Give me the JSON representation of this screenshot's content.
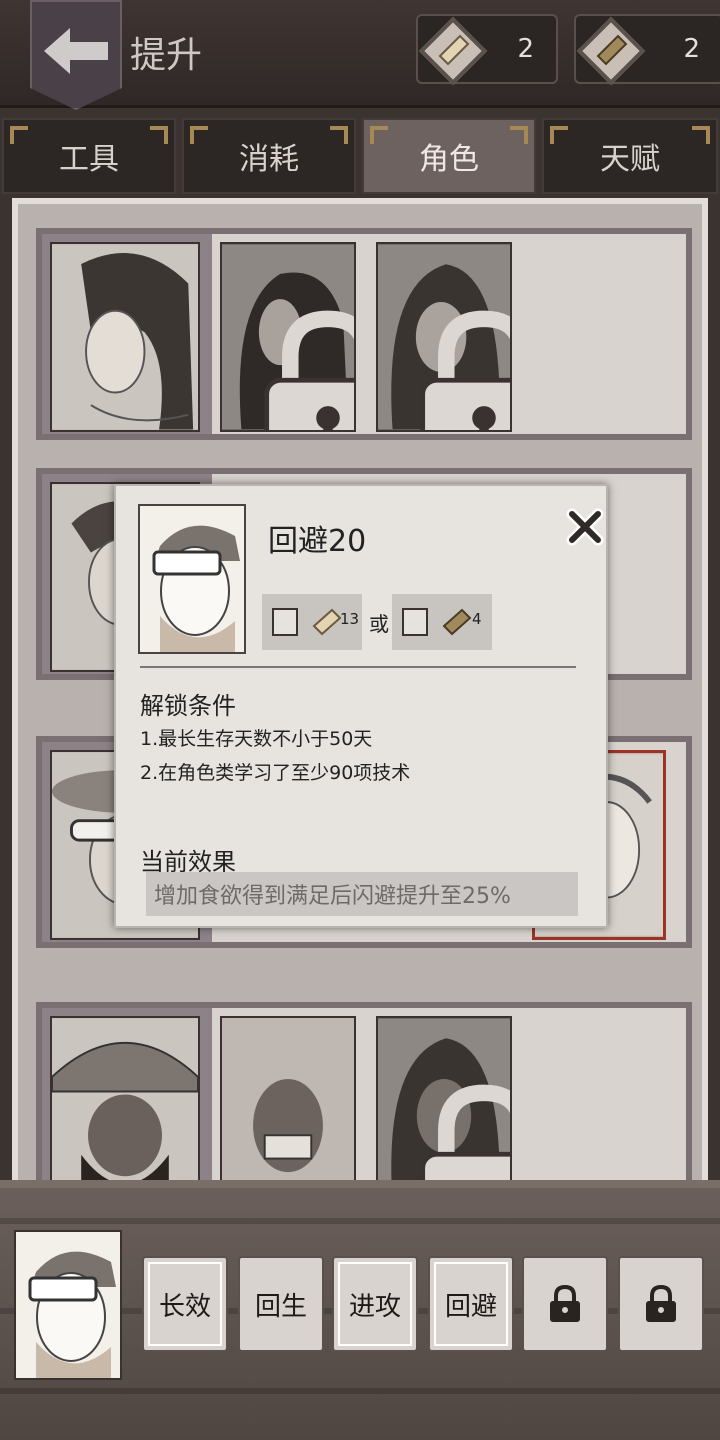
{
  "header": {
    "title": "提升",
    "currency": [
      {
        "icon": "light-scroll-icon",
        "count": "2"
      },
      {
        "icon": "dark-scroll-icon",
        "count": "2"
      }
    ]
  },
  "tabs": [
    {
      "label": "工具"
    },
    {
      "label": "消耗"
    },
    {
      "label": "角色",
      "active": true
    },
    {
      "label": "天赋"
    }
  ],
  "popup": {
    "title": "回避20",
    "cost_a": "13",
    "or_label": "或",
    "cost_b": "4",
    "unlock_heading": "解锁条件",
    "conditions": [
      "1.最长生存天数不小于50天",
      "2.在角色类学习了至少90项技术"
    ],
    "effect_heading": "当前效果",
    "effect_text": "增加食欲得到满足后闪避提升至25%"
  },
  "skills": [
    {
      "label": "长效",
      "framed": true
    },
    {
      "label": "回生",
      "framed": false
    },
    {
      "label": "进攻",
      "framed": true
    },
    {
      "label": "回避",
      "framed": true
    },
    {
      "label": "",
      "locked": true
    },
    {
      "label": "",
      "locked": true
    }
  ],
  "colors": {
    "accent_gold": "#a58a55",
    "selected_border": "#9c3324"
  }
}
